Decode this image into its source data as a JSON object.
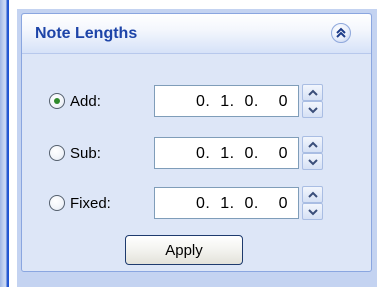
{
  "panel": {
    "title": "Note Lengths",
    "collapse_icon": "double-chevron-up-icon"
  },
  "rows": [
    {
      "label": "Add:",
      "selected": true,
      "value": "0.  1.  0.    0"
    },
    {
      "label": "Sub:",
      "selected": false,
      "value": "0.  1.  0.    0"
    },
    {
      "label": "Fixed:",
      "selected": false,
      "value": "0.  1.  0.    0"
    }
  ],
  "apply_label": "Apply",
  "colors": {
    "title": "#1d44a8",
    "panel_bg": "#dde6f7",
    "radio_dot": "#2f8a2b"
  }
}
